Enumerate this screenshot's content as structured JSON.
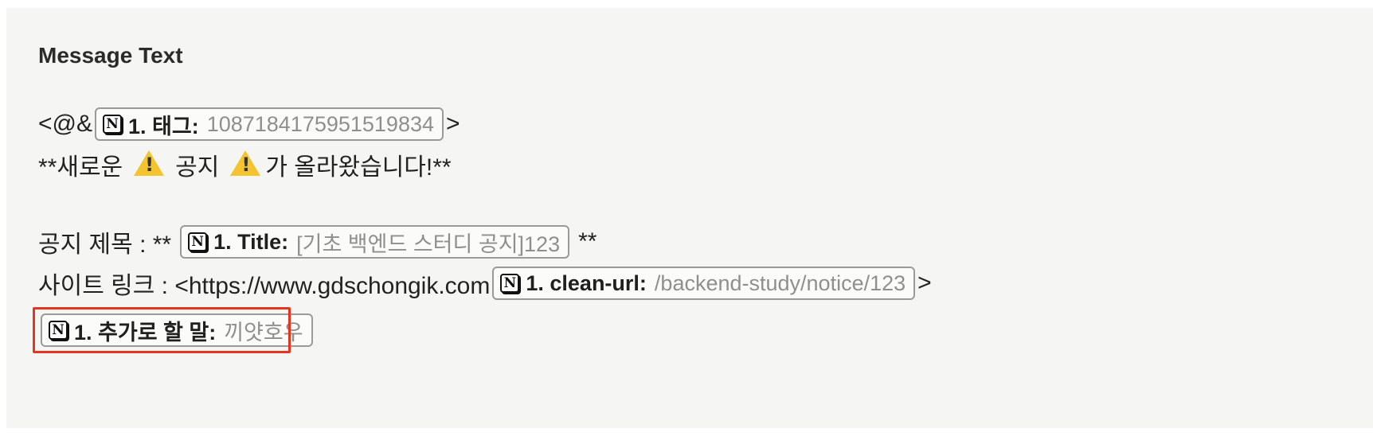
{
  "field_label": "Message Text",
  "line1": {
    "prefix": "<@&",
    "pill": {
      "key": "1. 태그:",
      "value": "1087184175951519834"
    },
    "suffix": ">"
  },
  "line2": {
    "part1": "**새로운",
    "part2": "공지",
    "part3": "가 올라왔습니다!**"
  },
  "line3": {
    "prefix": "공지 제목 : **",
    "pill": {
      "key": "1. Title:",
      "value": "[기초 백엔드 스터디 공지]123"
    },
    "suffix": "**"
  },
  "line4": {
    "prefix": "사이트 링크 : <https://www.gdschongik.com",
    "pill": {
      "key": "1. clean-url:",
      "value": "/backend-study/notice/123"
    },
    "suffix": ">"
  },
  "line5": {
    "pill": {
      "key": "1. 추가로 할 말:",
      "value": "끼얏호우"
    }
  },
  "colors": {
    "highlight": "#e5351f",
    "warning": "#f4c430"
  },
  "icons": {
    "pill_icon": "notion-icon",
    "emoji": "warning-icon"
  }
}
